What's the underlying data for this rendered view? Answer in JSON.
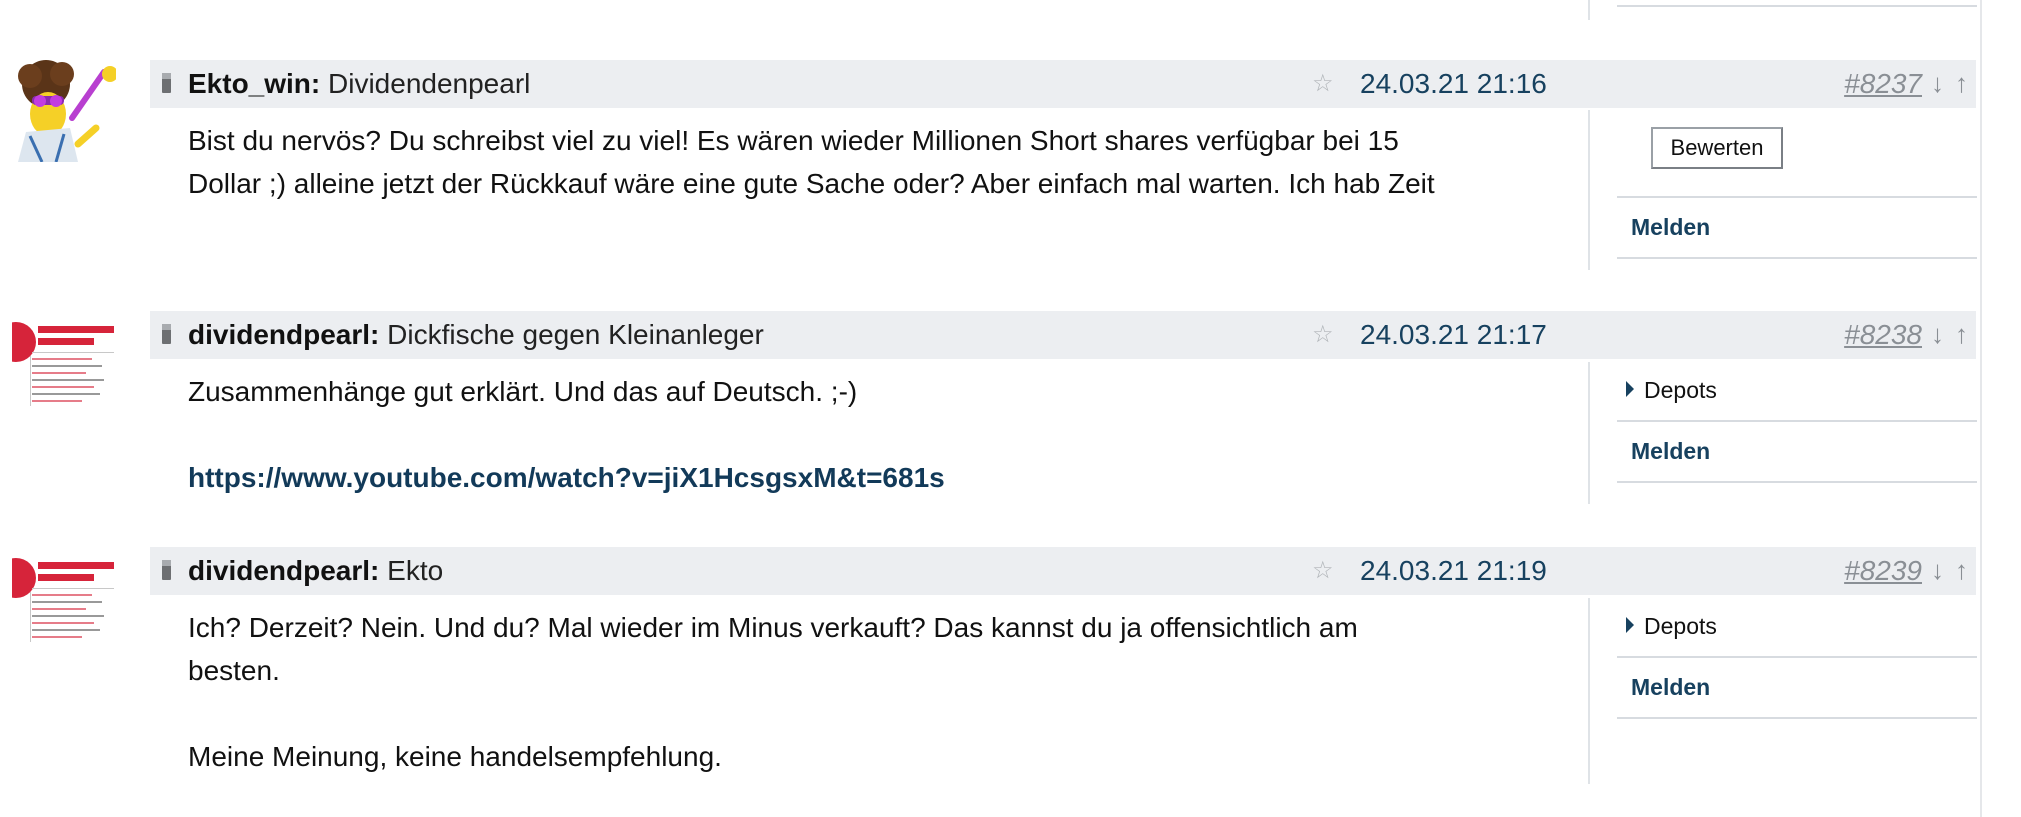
{
  "posts": [
    {
      "author": "Ekto_win:",
      "title": "Dividendenpearl",
      "timestamp": "24.03.21 21:16",
      "post_number": "#8237",
      "body": [
        "Bist du nervös? Du schreibst viel zu viel! Es wären wieder Millionen Short shares verfügbar bei 15",
        "Dollar ;) alleine jetzt der Rückkauf wäre eine gute Sache oder? Aber einfach mal warten. Ich hab Zeit"
      ],
      "actions": {
        "rate_label": "Bewerten",
        "report_label": "Melden"
      }
    },
    {
      "author": "dividendpearl:",
      "title": "Dickfische gegen Kleinanleger",
      "timestamp": "24.03.21 21:17",
      "post_number": "#8238",
      "body": [
        "Zusammenhänge gut erklärt. Und das auf Deutsch. ;-)"
      ],
      "link": "https://www.youtube.com/watch?v=jiX1HcsgsxM&t=681s",
      "actions": {
        "depots_label": "Depots",
        "report_label": "Melden"
      }
    },
    {
      "author": "dividendpearl:",
      "title": "Ekto",
      "timestamp": "24.03.21 21:19",
      "post_number": "#8239",
      "body": [
        "Ich? Derzeit? Nein. Und du? Mal wieder im Minus verkauft? Das kannst du ja offensichtlich am",
        "besten.",
        "Meine Meinung, keine handelsempfehlung."
      ],
      "actions": {
        "depots_label": "Depots",
        "report_label": "Melden"
      }
    }
  ],
  "icons": {
    "favorite": "star-icon",
    "down": "arrow-down-icon",
    "up": "arrow-up-icon",
    "expand": "caret-right-icon",
    "grip": "drag-handle-icon"
  },
  "colors": {
    "header_bg": "#eceef1",
    "accent": "#17415f",
    "link": "#123a59",
    "muted": "#8a8f95"
  }
}
